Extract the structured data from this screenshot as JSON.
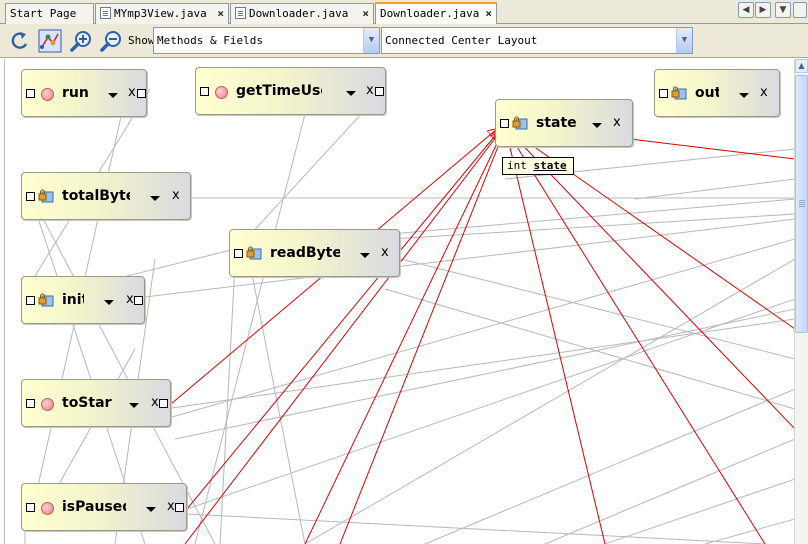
{
  "tabs": [
    {
      "label": "Start Page",
      "icon": "none",
      "closable": false,
      "active": false
    },
    {
      "label": "MYmp3View.java",
      "icon": "java-file-icon",
      "closable": true,
      "active": false
    },
    {
      "label": "Downloader.java",
      "icon": "java-file-icon",
      "closable": true,
      "active": false
    },
    {
      "label": "Downloader.java",
      "icon": "none",
      "closable": true,
      "active": true
    }
  ],
  "tab_close_glyph": "×",
  "nav": {
    "left": "◀",
    "right": "▶",
    "list": "▼"
  },
  "toolbar": {
    "show_label": "Show",
    "filter_value": "Methods & Fields",
    "layout_value": "Connected Center Layout",
    "dropdown_glyph": "▼"
  },
  "nodes": {
    "run": {
      "label": "run",
      "kind": "method"
    },
    "getTimeUsed": {
      "label": "getTimeUsec",
      "kind": "method"
    },
    "state": {
      "label": "state",
      "kind": "field"
    },
    "out": {
      "label": "out",
      "kind": "field"
    },
    "totalBytes": {
      "label": "totalBytes",
      "kind": "field"
    },
    "readBytes": {
      "label": "readBytes",
      "kind": "field"
    },
    "init": {
      "label": "init",
      "kind": "field"
    },
    "toStart": {
      "label": "toStart",
      "kind": "method"
    },
    "isPaused": {
      "label": "isPaused",
      "kind": "method"
    }
  },
  "node_x": "x",
  "tooltip": {
    "type": "int",
    "name": "state"
  },
  "colors": {
    "usage_edge": "#dd0000",
    "edge": "#b0b0b0",
    "tab_accent": "#f0a030"
  }
}
